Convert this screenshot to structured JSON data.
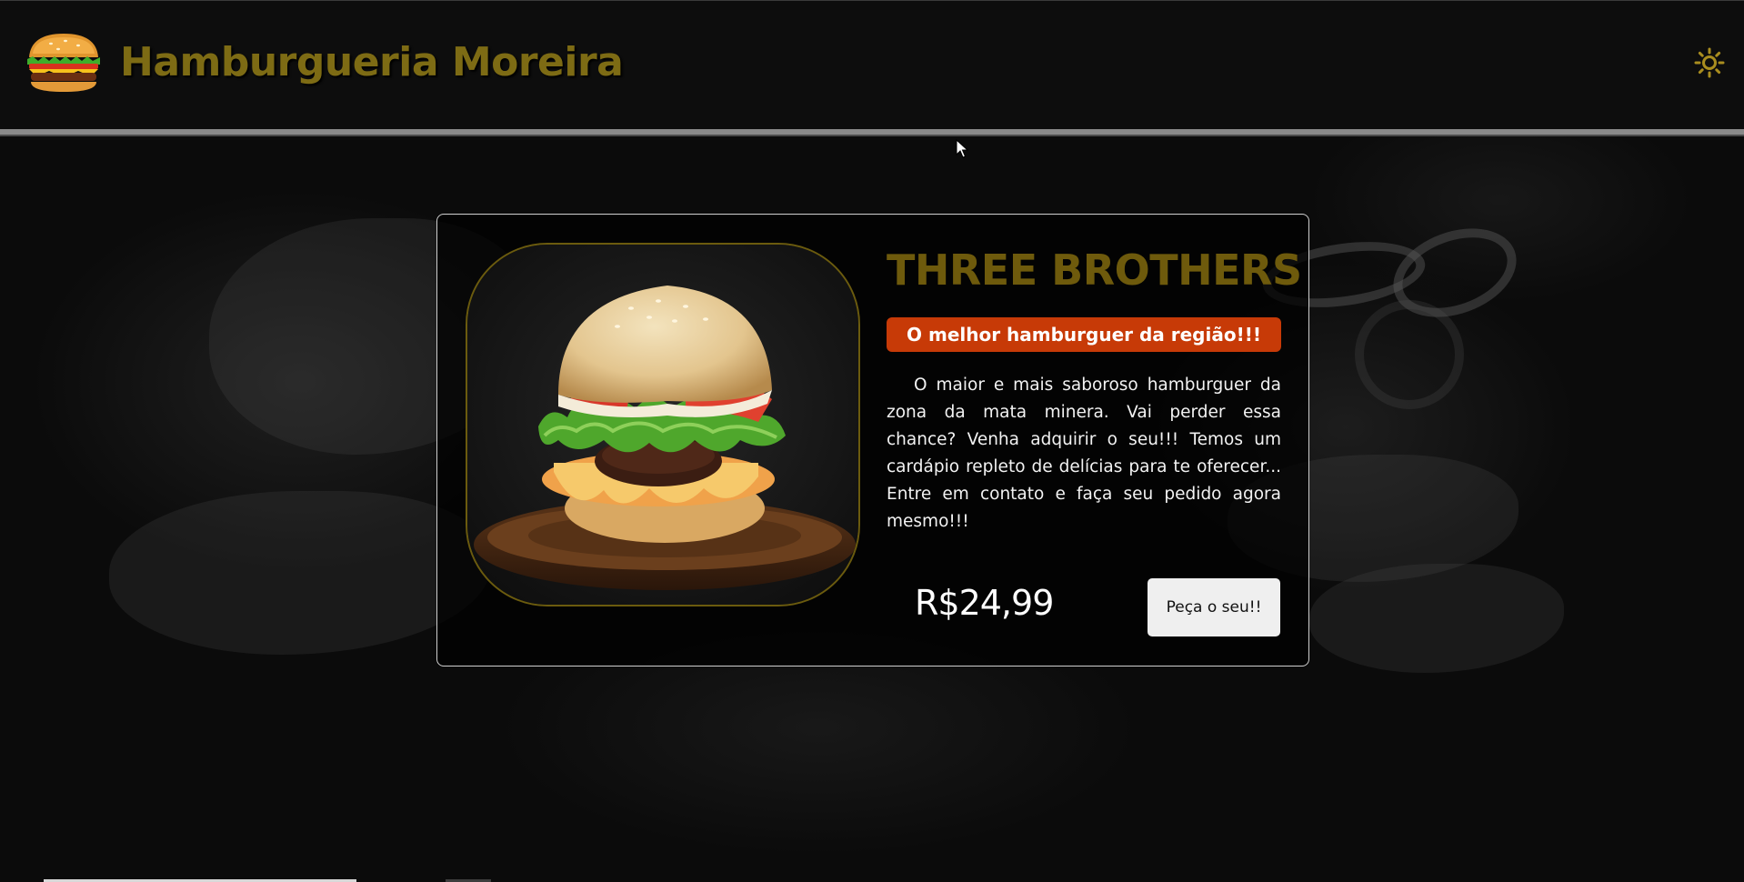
{
  "header": {
    "title": "Hamburgueria Moreira",
    "logo_icon": "burger-icon",
    "theme_toggle_icon": "sun-icon"
  },
  "product": {
    "name": "THREE BROTHERS",
    "tagline": "O melhor hamburguer da região!!!",
    "description": "O maior e mais saboroso hamburguer da zona da mata minera. Vai perder essa chance? Venha adquirir o seu!!! Temos um cardápio repleto de delícias para te oferecer... Entre em contato e faça seu pedido agora mesmo!!!",
    "price": "R$24,99",
    "order_button_label": "Peça o seu!!"
  },
  "colors": {
    "title_gold": "#7d6b14",
    "tagline_bg": "#c73a07",
    "background": "#0b0b0b"
  }
}
